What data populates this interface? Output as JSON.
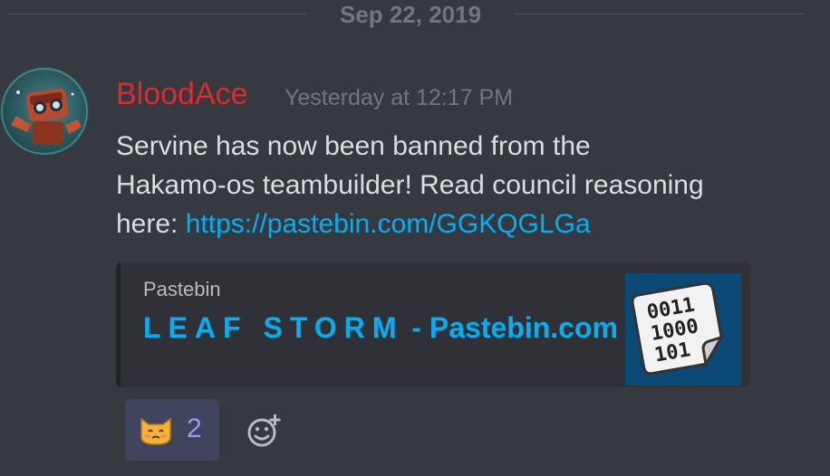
{
  "date_divider": {
    "text": "Sep 22, 2019"
  },
  "message": {
    "author": "BloodAce",
    "author_color": "#e02a2a",
    "timestamp": "Yesterday at 12:17 PM",
    "text_line1": "Servine has now been banned from the",
    "text_line2": "Hakamo-os teambuilder! Read council reasoning",
    "text_line3_prefix": "here: ",
    "link": "https://pastebin.com/GGKQGLGa"
  },
  "embed": {
    "provider": "Pastebin",
    "title_spaced": "LEAF STORM",
    "title_rest": " - Pastebin.com",
    "thumbnail_icon": "binary-document-icon",
    "thumbnail_lines": [
      "0011",
      "1000",
      "101"
    ]
  },
  "reactions": [
    {
      "emoji": "cat-emoji",
      "count": "2"
    }
  ],
  "add_reaction_icon": "add-reaction-icon",
  "colors": {
    "background": "#36393f",
    "link": "#00aff4",
    "reaction_active": "#40445c",
    "reaction_count": "#8f9ff5"
  }
}
